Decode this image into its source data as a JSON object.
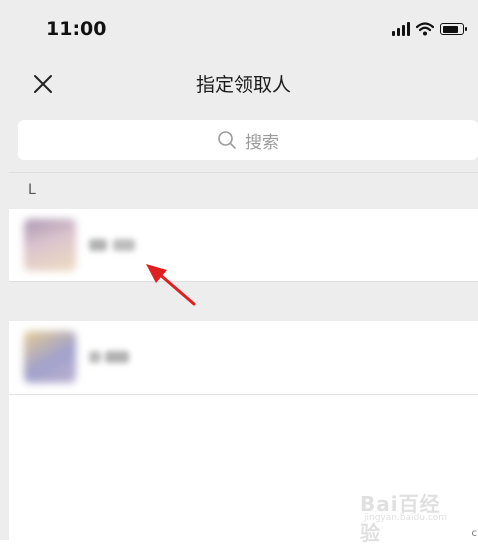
{
  "status_bar": {
    "time": "11:00"
  },
  "nav": {
    "title": "指定领取人",
    "close_icon": "close-x"
  },
  "search": {
    "placeholder": "搜索",
    "icon": "search-icon"
  },
  "sections": [
    {
      "label": "L",
      "contacts": [
        {
          "name": "",
          "avatar_colors": [
            "#c9a6b4",
            "#e5c9a0",
            "#7a5e86"
          ]
        }
      ]
    },
    {
      "label": "",
      "contacts": [
        {
          "name": "",
          "avatar_colors": [
            "#6f6fb0",
            "#d8b25a",
            "#9a8ab8"
          ]
        }
      ]
    }
  ],
  "annotation": {
    "arrow_color": "#e02020"
  },
  "watermark": {
    "main": "Bai百经验",
    "sub": "jingyan.baidu.com"
  },
  "colors": {
    "background": "#ededed",
    "row": "#ffffff",
    "text": "#111111",
    "muted": "#9a9a9a"
  }
}
